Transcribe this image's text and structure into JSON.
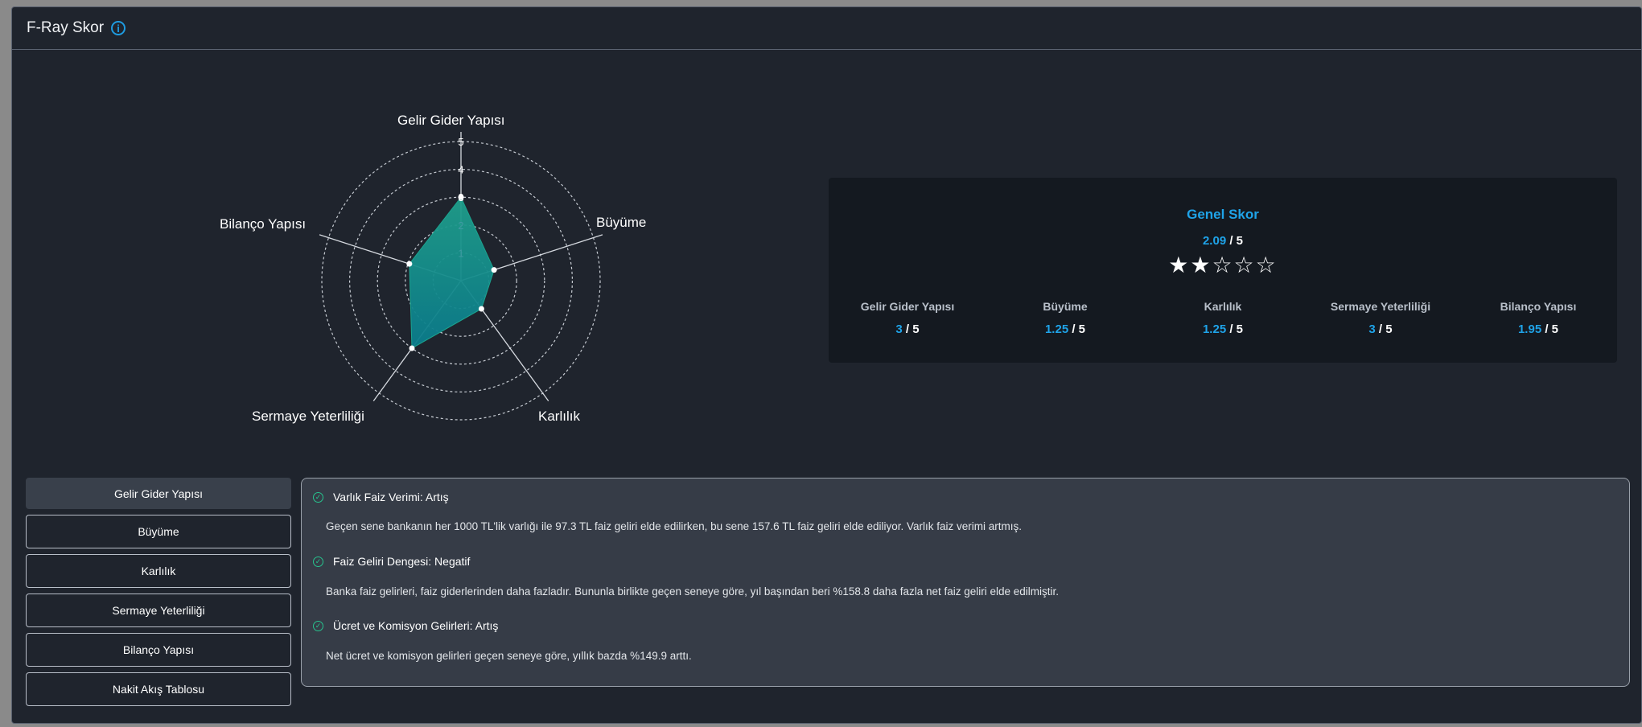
{
  "header": {
    "title": "F-Ray Skor",
    "info_icon": "info-icon"
  },
  "radar": {
    "axes": [
      "Gelir Gider Yapısı",
      "Büyüme",
      "Karlılık",
      "Sermaye Yeterliliği",
      "Bilanço Yapısı"
    ],
    "ticks": [
      "1",
      "2",
      "3",
      "4",
      "5"
    ],
    "max": 5,
    "values": [
      3,
      1.25,
      1.25,
      3,
      1.95
    ],
    "fill_colors": [
      "#1f9e8a",
      "#0a7c8c"
    ]
  },
  "score_card": {
    "title": "Genel Skor",
    "overall": "2.09",
    "overall_max": "/ 5",
    "stars": {
      "filled": 2,
      "total": 5
    },
    "items": [
      {
        "label": "Gelir Gider Yapısı",
        "value": "3",
        "max": "/ 5"
      },
      {
        "label": "Büyüme",
        "value": "1.25",
        "max": "/ 5"
      },
      {
        "label": "Karlılık",
        "value": "1.25",
        "max": "/ 5"
      },
      {
        "label": "Sermaye Yeterliliği",
        "value": "3",
        "max": "/ 5"
      },
      {
        "label": "Bilanço Yapısı",
        "value": "1.95",
        "max": "/ 5"
      }
    ]
  },
  "tabs": [
    {
      "label": "Gelir Gider Yapısı",
      "active": true
    },
    {
      "label": "Büyüme"
    },
    {
      "label": "Karlılık"
    },
    {
      "label": "Sermaye Yeterliliği"
    },
    {
      "label": "Bilanço Yapısı"
    },
    {
      "label": "Nakit Akış Tablosu"
    }
  ],
  "details": [
    {
      "title": "Varlık Faiz Verimi: Artış",
      "text": "Geçen sene bankanın her 1000 TL'lik varlığı ile 97.3 TL faiz geliri elde edilirken, bu sene 157.6 TL faiz geliri elde ediliyor. Varlık faiz verimi artmış."
    },
    {
      "title": "Faiz Geliri Dengesi: Negatif",
      "text": "Banka faiz gelirleri, faiz giderlerinden daha fazladır. Bununla birlikte geçen seneye göre, yıl başından beri %158.8 daha fazla net faiz geliri elde edilmiştir."
    },
    {
      "title": "Ücret ve Komisyon Gelirleri: Artış",
      "text": "Net ücret ve komisyon gelirleri geçen seneye göre, yıllık bazda %149.9 arttı."
    }
  ],
  "colors": {
    "accent": "#1fa3e8",
    "panel_bg": "#1f242d",
    "check": "#27c38e"
  }
}
